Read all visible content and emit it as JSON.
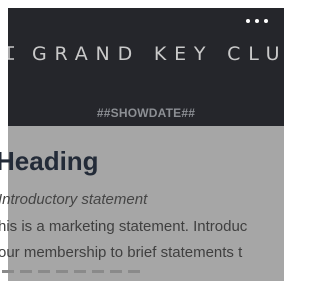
{
  "header": {
    "brand": "GRAND KEY CLU",
    "show_date": "##SHOWDATE##",
    "more_label": "More options"
  },
  "content": {
    "heading": "Heading",
    "intro": "Introductory statement",
    "paragraph_lines": [
      "his is a marketing statement. Introduc",
      "our membership to brief statements t"
    ]
  },
  "colors": {
    "header_bg": "#25262b",
    "overlay": "#a6a6a6",
    "heading": "#232b38"
  }
}
